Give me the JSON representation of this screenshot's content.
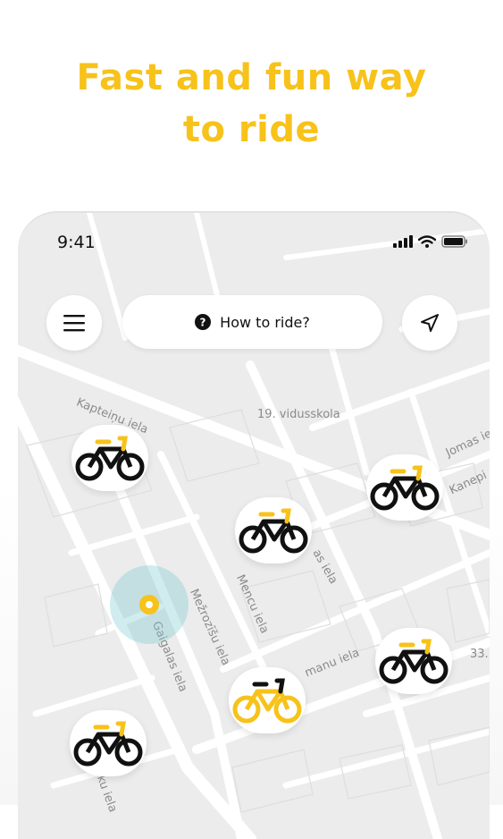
{
  "headline": {
    "line1": "Fast and fun way",
    "line2": "to ride"
  },
  "status_bar": {
    "time": "9:41"
  },
  "map_header": {
    "menu_icon": "hamburger-icon",
    "help_pill_label": "How to ride?",
    "help_icon": "question-circle-icon",
    "locate_icon": "navigation-arrow-icon"
  },
  "map_labels": {
    "kapteinu": "Kapteiņu iela",
    "school": "19. vidusskola",
    "jomas": "Jomas iela",
    "kanepes": "Kaneрі",
    "as_iela": "as iela",
    "mencu": "Mencu iela",
    "mezrozisu": "Mežrozīšu iela",
    "gaigalas": "Gaigalas iela",
    "manu": "manu iela",
    "num33": "33.",
    "ku_iela": "ku iela"
  },
  "bikes": [
    {
      "id": "bike-1",
      "color": "#f7c21a",
      "state": "available"
    },
    {
      "id": "bike-2",
      "color": "#f7c21a",
      "state": "available"
    },
    {
      "id": "bike-3",
      "color": "#f7c21a",
      "state": "available"
    },
    {
      "id": "bike-4",
      "color": "#f7c21a",
      "state": "available"
    },
    {
      "id": "bike-5",
      "color": "#f7c21a",
      "state": "selected"
    },
    {
      "id": "bike-6",
      "color": "#f7c21a",
      "state": "available"
    }
  ],
  "colors": {
    "accent": "#f7c21a",
    "map_bg": "#ececec",
    "road": "#ffffff",
    "text": "#111111"
  }
}
